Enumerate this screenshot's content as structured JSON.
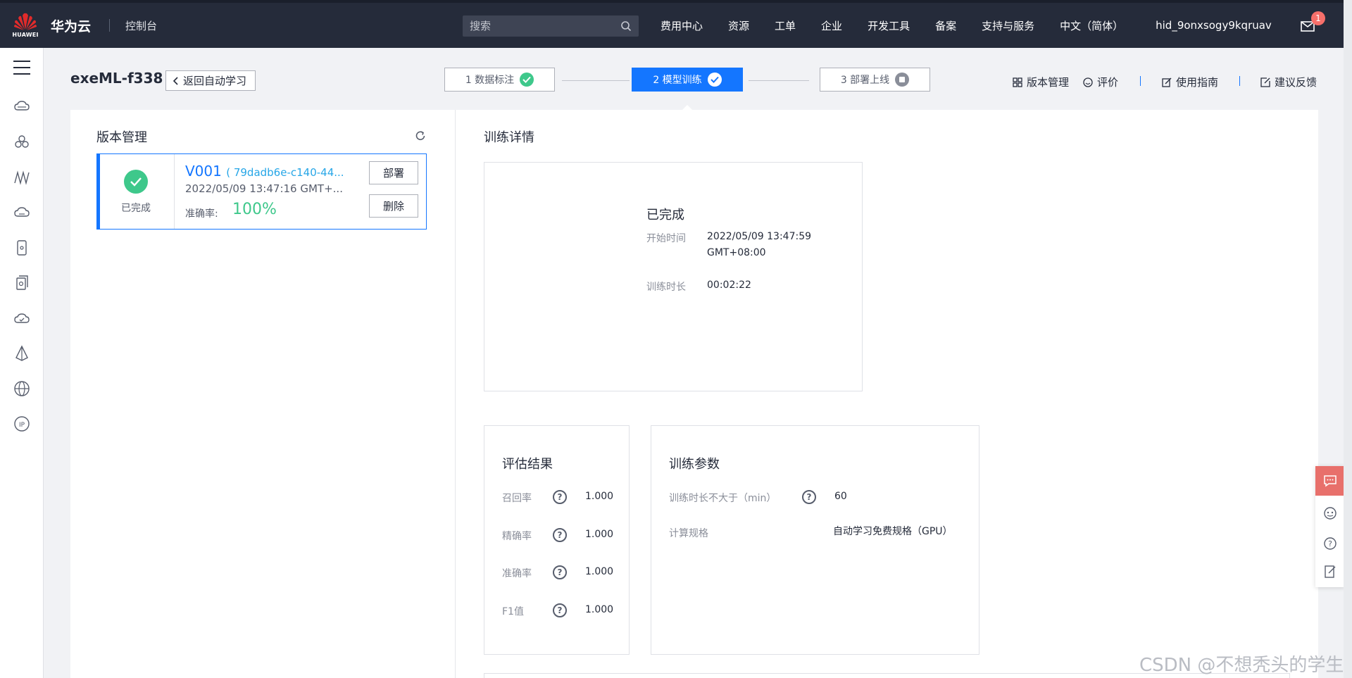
{
  "topbar": {
    "brand_mini": "HUAWEI",
    "brand_title": "华为云",
    "console": "控制台",
    "search_placeholder": "搜索",
    "nav": [
      "费用中心",
      "资源",
      "工单",
      "企业",
      "开发工具",
      "备案",
      "支持与服务"
    ],
    "language": "中文（简体）",
    "username": "hid_9onxsogy9kqruav",
    "mail_badge": "1"
  },
  "subheader": {
    "project_title": "exeML-f338",
    "back_label": "返回自动学习",
    "steps": [
      {
        "label": "1 数据标注",
        "state": "done"
      },
      {
        "label": "2 模型训练",
        "state": "active"
      },
      {
        "label": "3 部署上线",
        "state": "pending"
      }
    ],
    "tools": {
      "version": "版本管理",
      "rate": "评价",
      "guide": "使用指南",
      "feedback": "建议反馈"
    }
  },
  "version_panel": {
    "title": "版本管理",
    "card": {
      "status": "已完成",
      "version": "V001",
      "hash": "( 79dadb6e-c140-44...",
      "time": "2022/05/09 13:47:16 GMT+...",
      "accuracy_label": "准确率:",
      "accuracy": "100%",
      "deploy_label": "部署",
      "delete_label": "删除"
    }
  },
  "training_detail": {
    "title": "训练详情",
    "status": "已完成",
    "start_label": "开始时间",
    "start_value_line1": "2022/05/09 13:47:59",
    "start_value_line2": "GMT+08:00",
    "duration_label": "训练时长",
    "duration_value": "00:02:22"
  },
  "evaluation": {
    "title": "评估结果",
    "metrics": [
      {
        "label": "召回率",
        "value": "1.000"
      },
      {
        "label": "精确率",
        "value": "1.000"
      },
      {
        "label": "准确率",
        "value": "1.000"
      },
      {
        "label": "F1值",
        "value": "1.000"
      }
    ]
  },
  "params": {
    "title": "训练参数",
    "rows": [
      {
        "label": "训练时长不大于（min）",
        "value": "60"
      },
      {
        "label": "计算规格",
        "value": "自动学习免费规格（GPU）"
      }
    ]
  },
  "watermark": "CSDN @不想秃头的学生",
  "colors": {
    "topbar": "#252b3a",
    "accent": "#1476ff",
    "success": "#3ec88b",
    "chat": "#e8706b"
  }
}
